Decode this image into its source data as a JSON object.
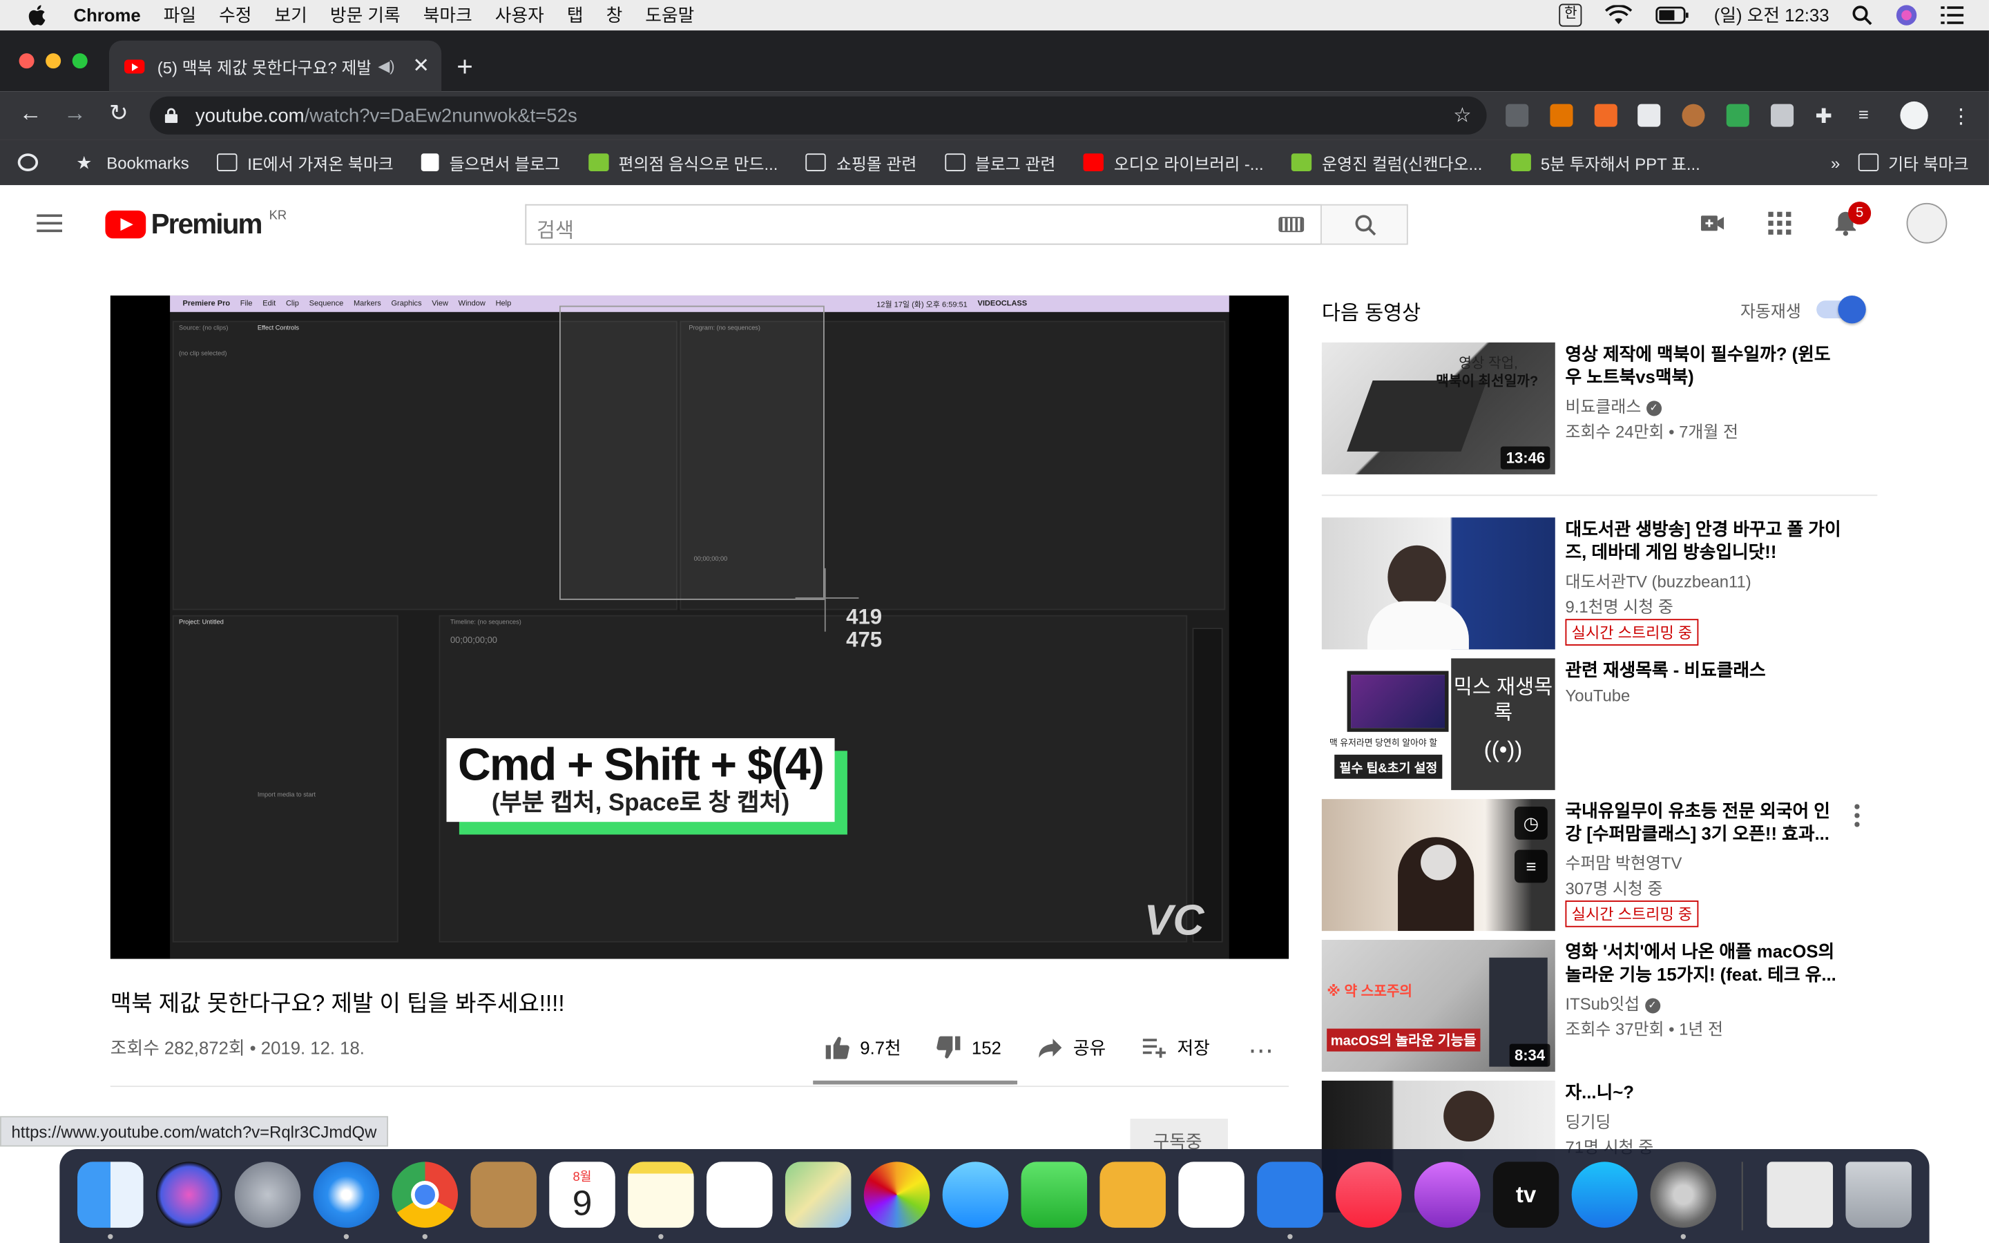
{
  "menubar": {
    "app": "Chrome",
    "items": [
      "파일",
      "수정",
      "보기",
      "방문 기록",
      "북마크",
      "사용자",
      "탭",
      "창",
      "도움말"
    ],
    "ime": "한",
    "clock": "(일) 오전 12:33"
  },
  "browser": {
    "tab_title": "(5) 맥북 제값 못한다구요? 제발",
    "url_host": "youtube.com",
    "url_path": "/watch?v=DaEw2nunwok&t=52s",
    "status_url": "https://www.youtube.com/watch?v=Rqlr3CJmdQw"
  },
  "bookmarks": {
    "items": [
      "Bookmarks",
      "IE에서 가져온 북마크",
      "들으면서 블로그",
      "편의점 음식으로 만드...",
      "쇼핑몰 관련",
      "블로그 관련",
      "오디오 라이브러리 -...",
      "운영진 컬럼(신캔다오...",
      "5분 투자해서 PPT 표..."
    ],
    "more": "»",
    "other": "기타 북마크"
  },
  "youtube": {
    "logo_word": "Premium",
    "region": "KR",
    "search_placeholder": "검색",
    "notification_count": "5"
  },
  "player": {
    "pr_menu": [
      "Premiere Pro",
      "File",
      "Edit",
      "Clip",
      "Sequence",
      "Markers",
      "Graphics",
      "View",
      "Window",
      "Help"
    ],
    "pr_status": "12월 17일 (화) 오후 6:59:51",
    "pr_brand": "VIDEOCLASS",
    "pr_source_tab": "Source: (no clips)",
    "pr_effect_tab": "Effect Controls",
    "pr_program": "Program: (no sequences)",
    "pr_no_clip": "(no clip selected)",
    "pr_project": "Project: Untitled",
    "pr_timeline": "Timeline: (no sequences)",
    "pr_import": "Import media to start",
    "pr_timecode": "00;00;00;00",
    "coord_x": "419",
    "coord_y": "475",
    "caption_main": "Cmd + Shift + $(4)",
    "caption_sub": "(부분 캡처, Space로 창 캡처)",
    "watermark": "VC"
  },
  "video": {
    "title": "맥북 제값 못한다구요? 제발 이 팁을 봐주세요!!!!",
    "meta": "조회수 282,872회 • 2019. 12. 18.",
    "likes": "9.7천",
    "dislikes": "152",
    "share": "공유",
    "save": "저장",
    "subscribe": "구독중",
    "like_ratio": 0.98
  },
  "sidebar": {
    "up_next": "다음 동영상",
    "autoplay": "자동재생",
    "autoplay_on": true,
    "items": [
      {
        "title": "영상 제작에 맥북이 필수일까? (윈도우 노트북vs맥북)",
        "channel": "비됴클래스",
        "stats": "조회수 24만회 • 7개월 전",
        "duration": "13:46",
        "thumb_text_1": "영상 작업,",
        "thumb_text_2": "맥북이 최선일까?"
      },
      {
        "title": "대도서관 생방송] 안경 바꾸고 폴 가이즈, 데바데 게임 방송입니닷!!",
        "channel": "대도서관TV (buzzbean11)",
        "stats": "9.1천명 시청 중",
        "live": "실시간 스트리밍 중"
      },
      {
        "title": "관련 재생목록 - 비됴클래스",
        "channel": "YouTube",
        "mix_label": "믹스 재생목록",
        "thumb_text_1": "맥 유저라면 당연히 알아야 할",
        "thumb_text_2": "필수 팁&초기 설정"
      },
      {
        "title": "국내유일무이 유초등 전문 외국어 인강 [수퍼맘클래스] 3기 오픈!! 효과...",
        "channel": "수퍼맘 박현영TV",
        "stats": "307명 시청 중",
        "live": "실시간 스트리밍 중"
      },
      {
        "title": "영화 '서치'에서 나온 애플 macOS의 놀라운 기능 15가지! (feat. 테크 유...",
        "channel": "ITSub잇섭",
        "stats": "조회수 37만회 • 1년 전",
        "duration": "8:34",
        "thumb_text_1": "※ 약 스포주의",
        "thumb_text_2": "macOS의 놀라운 기능들"
      },
      {
        "title": "자...니~?",
        "channel": "딩기딩",
        "stats": "71명 시청 중"
      }
    ]
  },
  "dock": {
    "calendar_month": "8월",
    "calendar_day": "9",
    "appletv": "tv"
  }
}
